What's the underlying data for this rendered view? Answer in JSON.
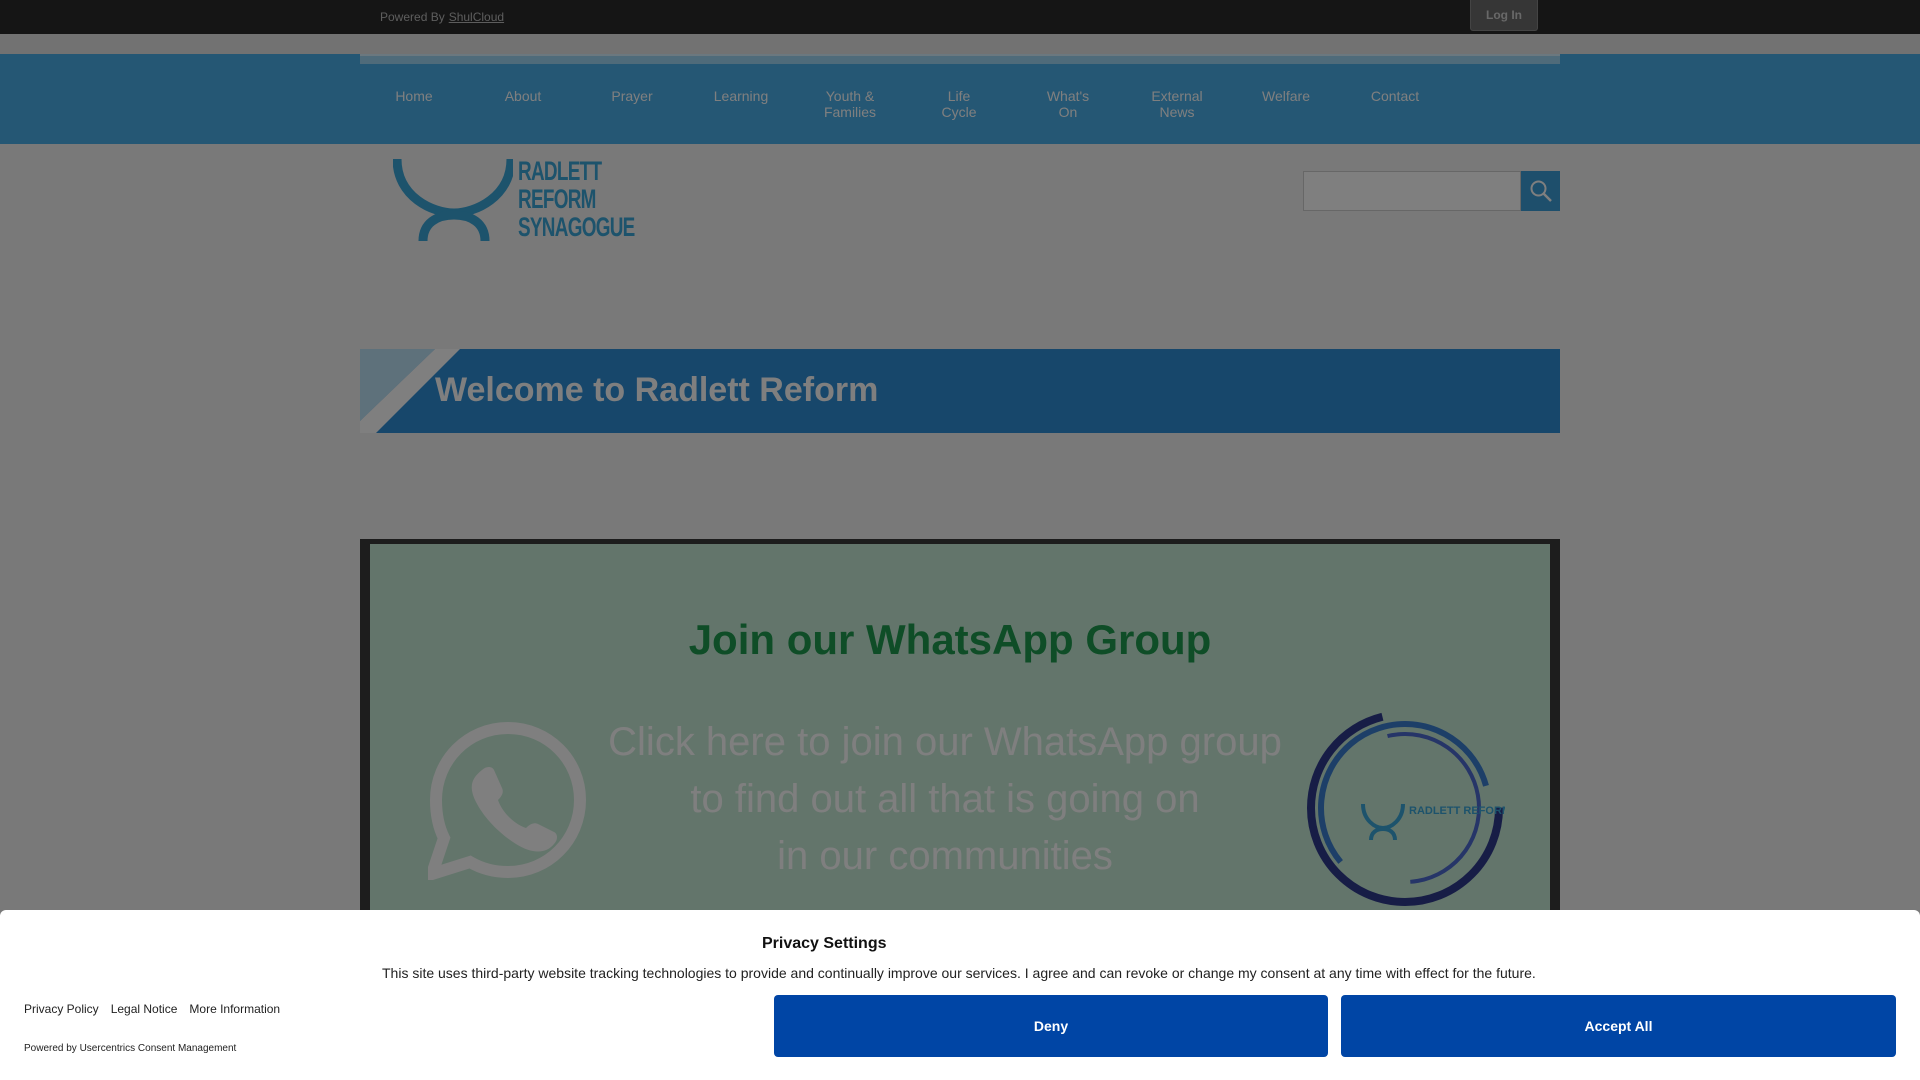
{
  "topbar": {
    "powered_by_label": "Powered By",
    "powered_by_link": "ShulCloud",
    "login_label": "Log In"
  },
  "nav": {
    "items": [
      {
        "label": "Home"
      },
      {
        "label": "About"
      },
      {
        "label": "Prayer"
      },
      {
        "label": "Learning"
      },
      {
        "label": "Youth &\nFamilies"
      },
      {
        "label": "Life\nCycle"
      },
      {
        "label": "What's\nOn"
      },
      {
        "label": "External\nNews"
      },
      {
        "label": "Welfare"
      },
      {
        "label": "Contact"
      }
    ]
  },
  "logo": {
    "line1": "RADLETT",
    "line2": "REFORM",
    "line3": "SYNAGOGUE"
  },
  "search": {
    "placeholder": "",
    "button_icon": "search-icon"
  },
  "welcome": {
    "title": "Welcome to Radlett Reform"
  },
  "banner": {
    "title": "Join our WhatsApp Group",
    "line1": "Click here to join our WhatsApp group",
    "line2": "to find out all that is going on",
    "line3": "in our communities",
    "icon": "whatsapp-icon",
    "partner_logo_text": "RADLETT REFORM SYNAGOGUE"
  },
  "consent": {
    "title": "Privacy Settings",
    "text": "This site uses third-party website tracking technologies to provide and continually improve our services. I agree and can revoke or change my consent at any time with effect for the future.",
    "links": [
      "Privacy Policy",
      "Legal Notice",
      "More Information"
    ],
    "powered_by": "Powered by Usercentrics Consent Management",
    "deny_label": "Deny",
    "accept_label": "Accept All"
  },
  "colors": {
    "nav": "#4aaee8",
    "welcome": "#2e8ed6",
    "banner_bg": "#c6ead6",
    "whatsapp_green": "#1e9a4e",
    "consent_button": "#0045a5"
  }
}
